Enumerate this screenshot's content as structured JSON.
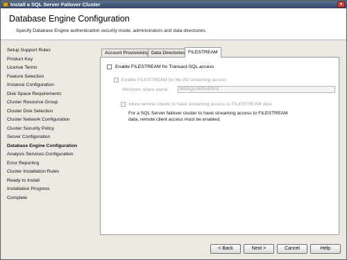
{
  "window": {
    "title": "Install a SQL Server Failover Cluster",
    "close_glyph": "×"
  },
  "header": {
    "title": "Database Engine Configuration",
    "subtitle": "Specify Database Engine authentication security mode, administrators and data directories."
  },
  "sidebar": {
    "items": [
      {
        "label": "Setup Support Rules"
      },
      {
        "label": "Product Key"
      },
      {
        "label": "License Terms"
      },
      {
        "label": "Feature Selection"
      },
      {
        "label": "Instance Configuration"
      },
      {
        "label": "Disk Space Requirements"
      },
      {
        "label": "Cluster Resource Group"
      },
      {
        "label": "Cluster Disk Selection"
      },
      {
        "label": "Cluster Network Configuration"
      },
      {
        "label": "Cluster Security Policy"
      },
      {
        "label": "Server Configuration"
      },
      {
        "label": "Database Engine Configuration",
        "active": true
      },
      {
        "label": "Analysis Services Configuration"
      },
      {
        "label": "Error Reporting"
      },
      {
        "label": "Cluster Installation Rules"
      },
      {
        "label": "Ready to Install"
      },
      {
        "label": "Installation Progress"
      },
      {
        "label": "Complete"
      }
    ]
  },
  "tabs": [
    {
      "label": "Account Provisioning"
    },
    {
      "label": "Data Directories"
    },
    {
      "label": "FILESTREAM",
      "active": true
    }
  ],
  "filestream": {
    "enable_tsql_label": "Enable FILESTREAM for Transact-SQL access",
    "enable_tsql_checked": false,
    "enable_file_io_label": "Enable FILESTREAM for file I/O streaming access",
    "share_name_label": "Windows share name:",
    "share_name_value": "MSSQLSERVER01",
    "allow_remote_label": "Allow remote clients to have streaming access to FILESTREAM data",
    "note": "For a SQL Server failover cluster to have streaming access to FILESTREAM data, remote client access must be enabled."
  },
  "buttons": {
    "back": "< Back",
    "next": "Next >",
    "cancel": "Cancel",
    "help": "Help"
  }
}
